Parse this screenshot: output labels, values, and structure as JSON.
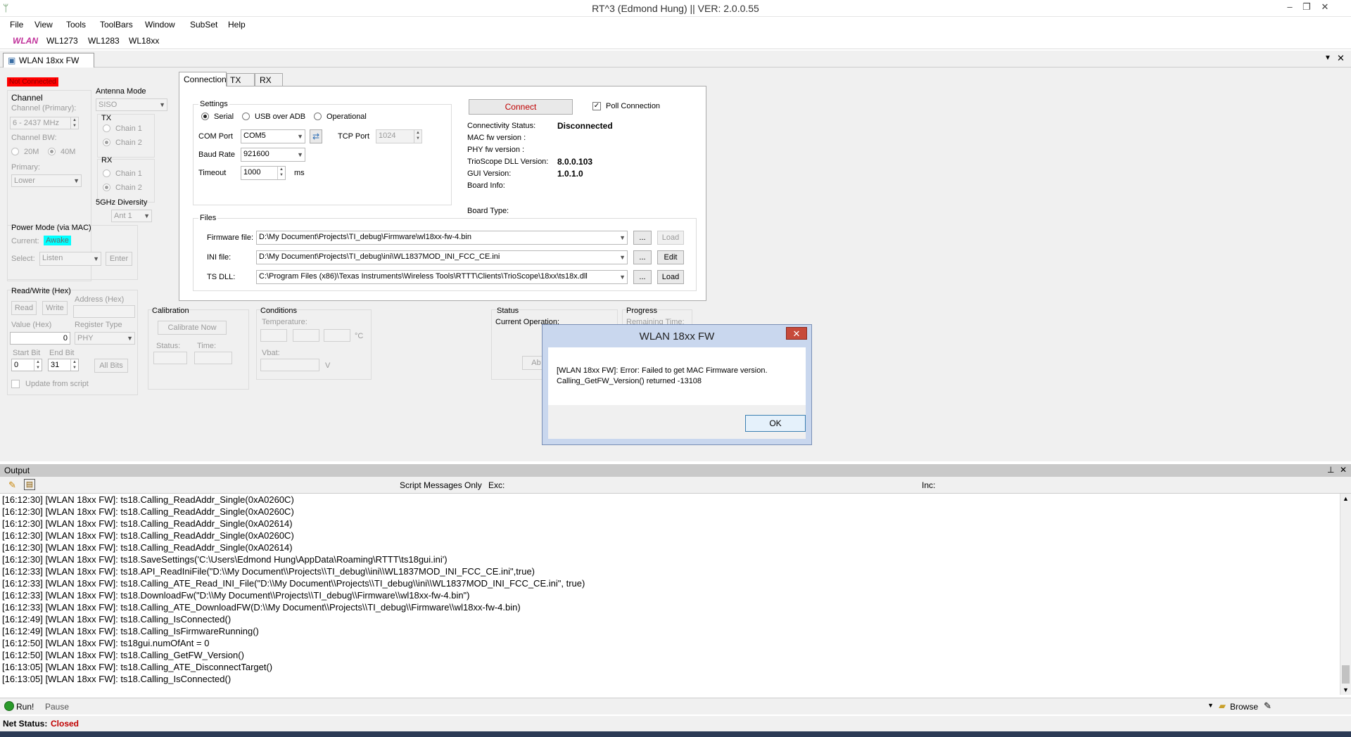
{
  "window": {
    "title": "RT^3 (Edmond Hung) || VER: 2.0.0.55"
  },
  "menu": [
    "File",
    "View",
    "Tools",
    "ToolBars",
    "Window",
    "SubSet",
    "Help"
  ],
  "toolbar": {
    "wlan": "WLAN",
    "items": [
      "WL1273",
      "WL1283",
      "WL18xx"
    ]
  },
  "doc_tab": "WLAN 18xx FW",
  "left": {
    "status_badge": "Not Connected",
    "channel": {
      "title": "Channel",
      "primary_label": "Channel (Primary):",
      "primary_value": "6  - 2437 MHz",
      "bw_label": "Channel BW:",
      "bw_20": "20M",
      "bw_40": "40M",
      "primary2_label": "Primary:",
      "primary2_value": "Lower"
    },
    "antenna": {
      "title": "Antenna Mode",
      "mode": "SISO",
      "tx": "TX",
      "rx": "RX",
      "chain1": "Chain 1",
      "chain2": "Chain 2",
      "div_title": "5GHz Diversity",
      "div_value": "Ant 1"
    },
    "power": {
      "title": "Power Mode (via MAC)",
      "current_label": "Current:",
      "current_value": "Awake",
      "select_label": "Select:",
      "select_value": "Listen",
      "enter": "Enter"
    },
    "rw": {
      "title": "Read/Write (Hex)",
      "read": "Read",
      "write": "Write",
      "address_label": "Address (Hex)",
      "value_label": "Value (Hex)",
      "value": "0",
      "regtype_label": "Register Type",
      "regtype_value": "PHY",
      "startbit_label": "Start Bit",
      "startbit": "0",
      "endbit_label": "End Bit",
      "endbit": "31",
      "allbits": "All Bits",
      "update_script": "Update from script"
    }
  },
  "tabs": [
    "Connection",
    "TX",
    "RX"
  ],
  "settings": {
    "title": "Settings",
    "serial": "Serial",
    "usb": "USB over ADB",
    "operational": "Operational",
    "com_label": "COM Port",
    "com_value": "COM5",
    "tcp_label": "TCP Port",
    "tcp_value": "1024",
    "baud_label": "Baud Rate",
    "baud_value": "921600",
    "timeout_label": "Timeout",
    "timeout_value": "1000",
    "timeout_unit": "ms"
  },
  "conn": {
    "connect": "Connect",
    "poll": "Poll Connection",
    "rows": [
      {
        "label": "Connectivity Status:",
        "value": "Disconnected"
      },
      {
        "label": "MAC fw version :",
        "value": ""
      },
      {
        "label": "PHY fw version :",
        "value": ""
      },
      {
        "label": "TrioScope DLL Version:",
        "value": "8.0.0.103"
      },
      {
        "label": "GUI Version:",
        "value": "1.0.1.0"
      },
      {
        "label": "Board Info:",
        "value": ""
      },
      {
        "label": "Board Type:",
        "value": ""
      }
    ]
  },
  "files": {
    "title": "Files",
    "rows": [
      {
        "label": "Firmware file:",
        "value": "D:\\My Document\\Projects\\TI_debug\\Firmware\\wl18xx-fw-4.bin",
        "browse": "...",
        "action": "Load"
      },
      {
        "label": "INI file:",
        "value": "D:\\My Document\\Projects\\TI_debug\\ini\\WL1837MOD_INI_FCC_CE.ini",
        "browse": "...",
        "action": "Edit"
      },
      {
        "label": "TS DLL:",
        "value": "C:\\Program Files (x86)\\Texas Instruments\\Wireless Tools\\RTTT\\Clients\\TrioScope\\18xx\\ts18x.dll",
        "browse": "...",
        "action": "Load"
      }
    ]
  },
  "calibration": {
    "title": "Calibration",
    "button": "Calibrate Now",
    "status": "Status:",
    "time": "Time:"
  },
  "conditions": {
    "title": "Conditions",
    "temperature": "Temperature:",
    "temp_unit": "°C",
    "vbat": "Vbat:",
    "vbat_unit": "V"
  },
  "status_panel": {
    "title": "Status",
    "current_op": "Current Operation:",
    "abort": "Ab"
  },
  "progress_panel": {
    "title": "Progress",
    "remaining": "Remaining Time:"
  },
  "dialog": {
    "title": "WLAN 18xx FW",
    "message_line1": "[WLAN 18xx FW]: Error: Failed to get MAC Firmware version.",
    "message_line2": "Calling_GetFW_Version() returned -13108",
    "ok": "OK"
  },
  "output": {
    "title": "Output",
    "script_only": "Script Messages Only",
    "exc": "Exc:",
    "inc": "Inc:",
    "lines": [
      "[16:12:30]  [WLAN 18xx FW]: ts18.Calling_ReadAddr_Single(0xA0260C)",
      "[16:12:30]  [WLAN 18xx FW]: ts18.Calling_ReadAddr_Single(0xA0260C)",
      "[16:12:30]  [WLAN 18xx FW]: ts18.Calling_ReadAddr_Single(0xA02614)",
      "[16:12:30]  [WLAN 18xx FW]: ts18.Calling_ReadAddr_Single(0xA0260C)",
      "[16:12:30]  [WLAN 18xx FW]: ts18.Calling_ReadAddr_Single(0xA02614)",
      "[16:12:30]  [WLAN 18xx FW]: ts18.SaveSettings('C:\\Users\\Edmond Hung\\AppData\\Roaming\\RTTT\\ts18gui.ini')",
      "[16:12:33]  [WLAN 18xx FW]: ts18.API_ReadIniFile(\"D:\\\\My Document\\\\Projects\\\\TI_debug\\\\ini\\\\WL1837MOD_INI_FCC_CE.ini\",true)",
      "[16:12:33]  [WLAN 18xx FW]: ts18.Calling_ATE_Read_INI_File(\"D:\\\\My Document\\\\Projects\\\\TI_debug\\\\ini\\\\WL1837MOD_INI_FCC_CE.ini\", true)",
      "[16:12:33]  [WLAN 18xx FW]: ts18.DownloadFw(\"D:\\\\My Document\\\\Projects\\\\TI_debug\\\\Firmware\\\\wl18xx-fw-4.bin\")",
      "[16:12:33]  [WLAN 18xx FW]: ts18.Calling_ATE_DownloadFW(D:\\\\My Document\\\\Projects\\\\TI_debug\\\\Firmware\\\\wl18xx-fw-4.bin)",
      "[16:12:49]  [WLAN 18xx FW]: ts18.Calling_IsConnected()",
      "[16:12:49]  [WLAN 18xx FW]: ts18.Calling_IsFirmwareRunning()",
      "[16:12:50]  [WLAN 18xx FW]: ts18gui.numOfAnt = 0",
      "[16:12:50]  [WLAN 18xx FW]: ts18.Calling_GetFW_Version()",
      "[16:13:05]  [WLAN 18xx FW]: ts18.Calling_ATE_DisconnectTarget()",
      "[16:13:05]  [WLAN 18xx FW]: ts18.Calling_IsConnected()"
    ]
  },
  "runbar": {
    "run": "Run!",
    "pause": "Pause",
    "browse": "Browse"
  },
  "statusbar": {
    "label": "Net Status:",
    "value": "Closed"
  },
  "colors": {
    "badge_red": "#ff0000",
    "awake_cyan": "#00ffff",
    "connect_red": "#c00000",
    "closed_red": "#c00000"
  }
}
